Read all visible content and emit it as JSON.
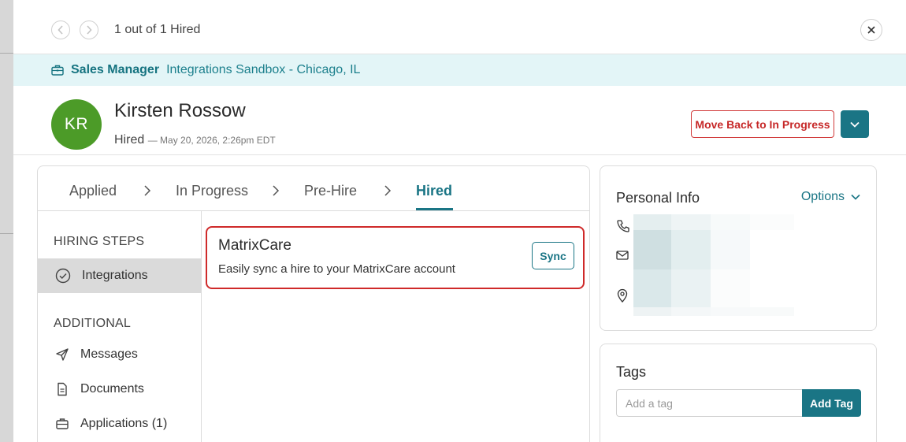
{
  "topbar": {
    "counter": "1 out of 1 Hired",
    "prev_icon": "chevron-left-icon",
    "next_icon": "chevron-right-icon",
    "close_icon": "close-icon"
  },
  "job": {
    "title": "Sales Manager",
    "location": "Integrations Sandbox - Chicago, IL"
  },
  "candidate": {
    "initials": "KR",
    "name": "Kirsten Rossow",
    "status": "Hired",
    "status_date": "— May 20, 2026, 2:26pm EDT",
    "move_back_label": "Move Back to In Progress"
  },
  "tabs": [
    {
      "label": "Applied"
    },
    {
      "label": "In Progress"
    },
    {
      "label": "Pre-Hire"
    },
    {
      "label": "Hired",
      "active": true
    }
  ],
  "sidebar": {
    "hiring_steps_heading": "HIRING STEPS",
    "hiring_items": [
      {
        "label": "Integrations",
        "icon": "check-circle-icon",
        "active": true
      }
    ],
    "additional_heading": "ADDITIONAL",
    "additional_items": [
      {
        "label": "Messages",
        "icon": "send-icon"
      },
      {
        "label": "Documents",
        "icon": "document-icon"
      },
      {
        "label": "Applications (1)",
        "icon": "briefcase-icon"
      }
    ]
  },
  "integration": {
    "title": "MatrixCare",
    "description": "Easily sync a hire to your MatrixCare account",
    "sync_label": "Sync"
  },
  "personal_info": {
    "heading": "Personal Info",
    "options_label": "Options"
  },
  "tags": {
    "heading": "Tags",
    "placeholder": "Add a tag",
    "add_label": "Add Tag"
  },
  "colors": {
    "accent": "#1a7585",
    "danger": "#c62828",
    "avatar": "#4c9b28",
    "job_bar": "#e3f5f7"
  }
}
